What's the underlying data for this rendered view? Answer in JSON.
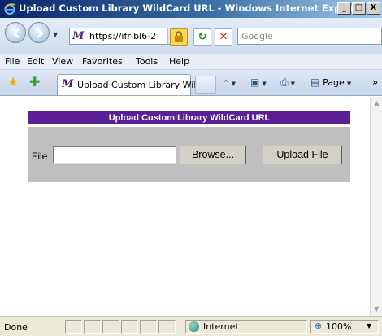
{
  "window": {
    "title": "Upload Custom Library WildCard URL - Windows Internet Explorer",
    "minimize": "_",
    "maximize": "□",
    "close": "X"
  },
  "address": {
    "url": "https://ifr-bl6-2",
    "search_placeholder": "Google"
  },
  "menu": [
    "File",
    "Edit",
    "View",
    "Favorites",
    "Tools",
    "Help"
  ],
  "tab": {
    "label": "Upload Custom Library Wil..."
  },
  "commands": {
    "page_label": "Page"
  },
  "form": {
    "header": "Upload Custom Library WildCard URL",
    "file_label": "File",
    "file_value": "",
    "browse_label": "Browse...",
    "upload_label": "Upload File"
  },
  "status": {
    "text": "Done",
    "zone": "Internet",
    "zoom": "100%"
  },
  "colors": {
    "header_bg": "#5b1f96",
    "panel_bg": "#bfbfbf"
  }
}
